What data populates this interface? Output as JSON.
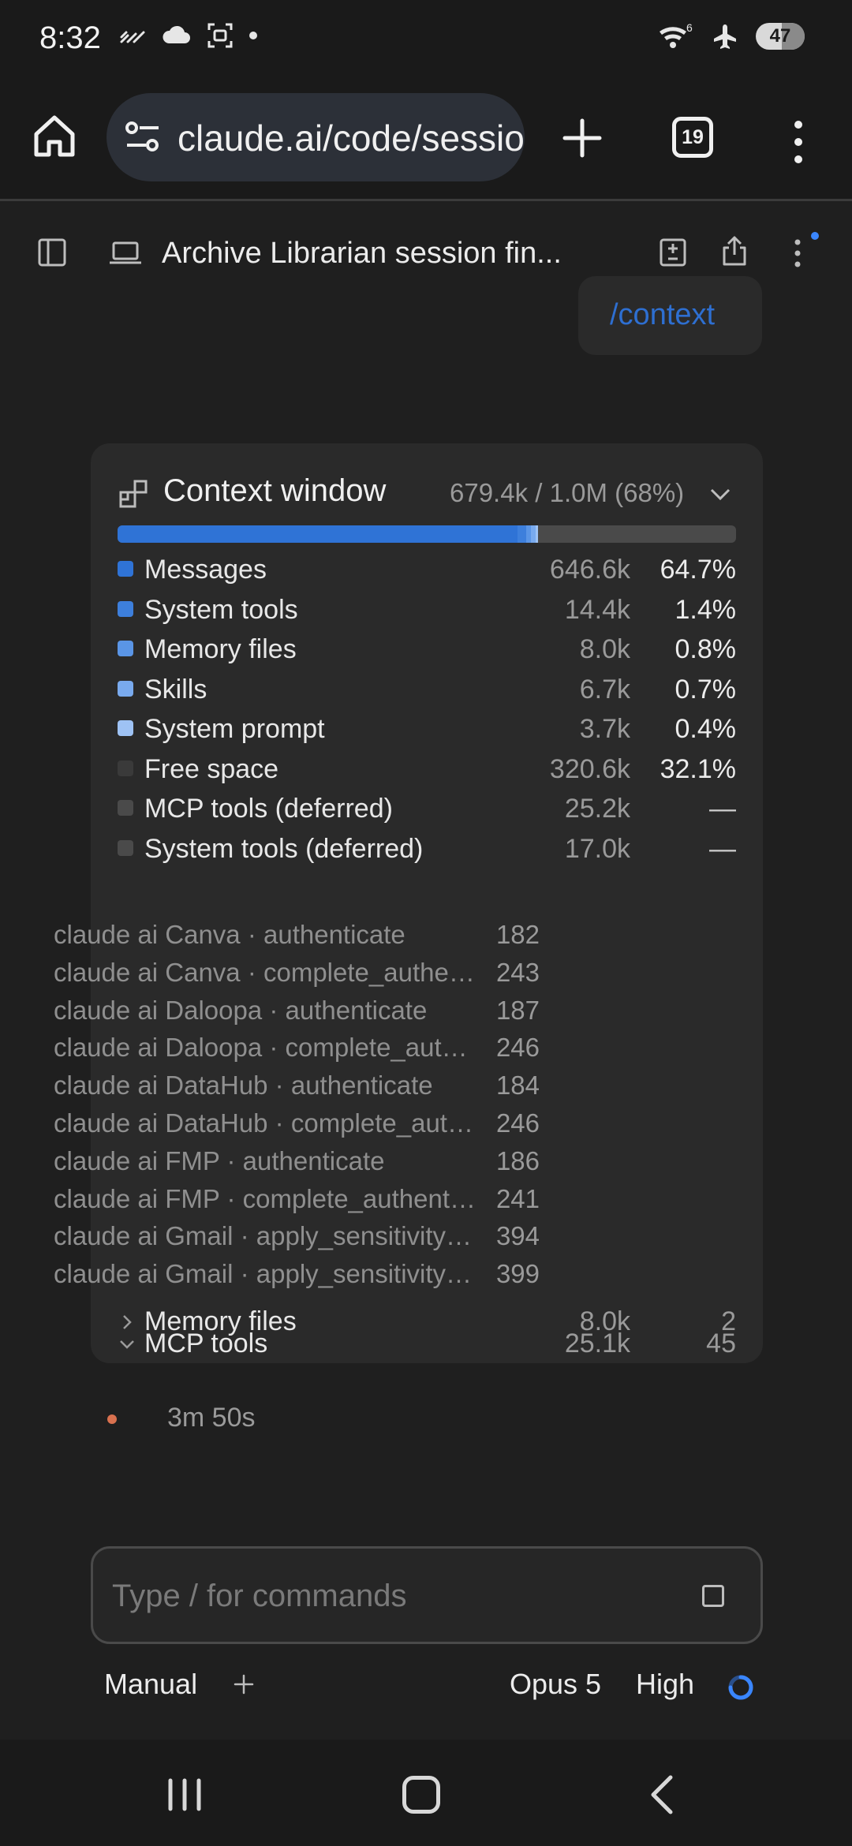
{
  "status_bar": {
    "time": "8:32",
    "left_icons": [
      "signal-slash-icon",
      "cloud-icon",
      "screenshot-icon",
      "dot-icon"
    ],
    "wifi_superscript": "6",
    "battery": "47"
  },
  "browser": {
    "url": "claude.ai/code/session",
    "tab_count": "19"
  },
  "header": {
    "title": "Archive Librarian session fin..."
  },
  "user_message": "/context",
  "context": {
    "title": "Context window",
    "summary": "679.4k / 1.0M (68%)",
    "usage_bar": [
      {
        "name": "Messages",
        "fraction": 0.647,
        "color": "#2f73d6"
      },
      {
        "name": "System tools",
        "fraction": 0.014,
        "color": "#3d7fdc"
      },
      {
        "name": "Memory files",
        "fraction": 0.008,
        "color": "#5a95e6"
      },
      {
        "name": "Skills",
        "fraction": 0.007,
        "color": "#79aaee"
      },
      {
        "name": "System prompt",
        "fraction": 0.004,
        "color": "#9ec2f4"
      }
    ],
    "rows": [
      {
        "label": "Messages",
        "tokens": "646.6k",
        "percent": "64.7%",
        "color": "#2f73d6"
      },
      {
        "label": "System tools",
        "tokens": "14.4k",
        "percent": "1.4%",
        "color": "#3d7fdc"
      },
      {
        "label": "Memory files",
        "tokens": "8.0k",
        "percent": "0.8%",
        "color": "#5a95e6"
      },
      {
        "label": "Skills",
        "tokens": "6.7k",
        "percent": "0.7%",
        "color": "#79aaee"
      },
      {
        "label": "System prompt",
        "tokens": "3.7k",
        "percent": "0.4%",
        "color": "#9ec2f4"
      },
      {
        "label": "Free space",
        "tokens": "320.6k",
        "percent": "32.1%",
        "color": "#3a3a3a"
      },
      {
        "label": "MCP tools (deferred)",
        "tokens": "25.2k",
        "percent": "—",
        "color": "#4a4a4a"
      },
      {
        "label": "System tools (deferred)",
        "tokens": "17.0k",
        "percent": "—",
        "color": "#4a4a4a"
      }
    ],
    "mcp_section": {
      "label": "MCP tools",
      "tokens": "25.1k",
      "count": "45",
      "tools": [
        {
          "name": "claude ai Canva · authenticate",
          "tokens": "182"
        },
        {
          "name": "claude ai Canva · complete_authentication",
          "tokens": "243"
        },
        {
          "name": "claude ai Daloopa · authenticate",
          "tokens": "187"
        },
        {
          "name": "claude ai Daloopa · complete_authentication",
          "tokens": "246"
        },
        {
          "name": "claude ai DataHub · authenticate",
          "tokens": "184"
        },
        {
          "name": "claude ai DataHub · complete_authentication",
          "tokens": "246"
        },
        {
          "name": "claude ai FMP · authenticate",
          "tokens": "186"
        },
        {
          "name": "claude ai FMP · complete_authentication",
          "tokens": "241"
        },
        {
          "name": "claude ai Gmail · apply_sensitivity_label",
          "tokens": "394"
        },
        {
          "name": "claude ai Gmail · apply_sensitivity_labels",
          "tokens": "399"
        }
      ]
    },
    "memory_section": {
      "label": "Memory files",
      "tokens": "8.0k",
      "count": "2"
    }
  },
  "timer": "3m 50s",
  "composer": {
    "placeholder": "Type / for commands",
    "mode": "Manual",
    "model": "Opus 5",
    "effort": "High"
  }
}
